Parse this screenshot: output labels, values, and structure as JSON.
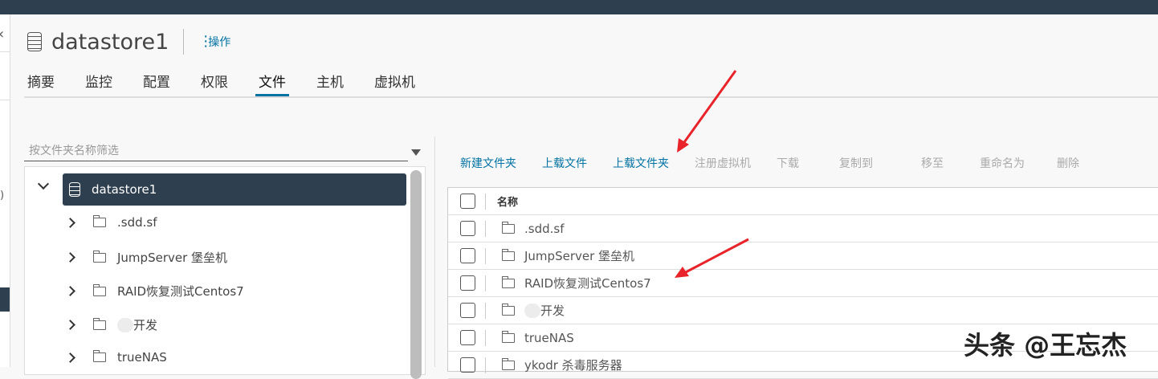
{
  "header": {
    "title": "datastore1",
    "actions_label": "操作"
  },
  "tabs": [
    "摘要",
    "监控",
    "配置",
    "权限",
    "文件",
    "主机",
    "虚拟机"
  ],
  "active_tab": "文件",
  "filter": {
    "placeholder": "按文件夹名称筛选"
  },
  "tree": {
    "root": "datastore1",
    "items": [
      ".sdd.sf",
      "JumpServer 堡垒机",
      "RAID恢复测试Centos7",
      "开发",
      "trueNAS"
    ]
  },
  "toolbar": {
    "enabled": [
      "新建文件夹",
      "上载文件",
      "上载文件夹"
    ],
    "disabled": [
      "注册虚拟机",
      "下载",
      "复制到",
      "移至",
      "重命名为",
      "删除"
    ]
  },
  "table": {
    "header": "名称",
    "rows": [
      ".sdd.sf",
      "JumpServer 堡垒机",
      "RAID恢复测试Centos7",
      "开发",
      "trueNAS",
      "ykodr 杀毒服务器"
    ]
  },
  "watermark": "头条 @王忘杰",
  "colors": {
    "accent": "#0072a3",
    "dark": "#2e3f4f",
    "arrow": "#e8232a"
  }
}
